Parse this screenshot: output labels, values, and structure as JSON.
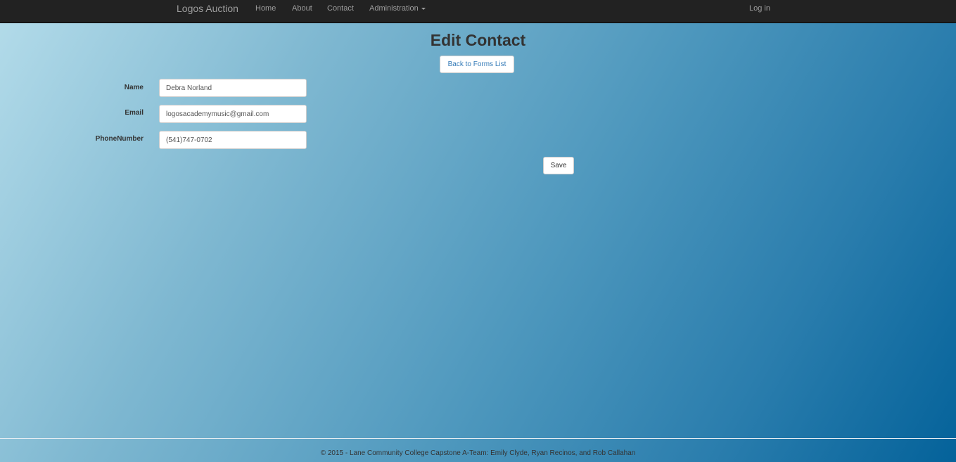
{
  "navbar": {
    "brand": "Logos Auction",
    "items": [
      {
        "label": "Home"
      },
      {
        "label": "About"
      },
      {
        "label": "Contact"
      },
      {
        "label": "Administration"
      }
    ],
    "login": "Log in"
  },
  "main": {
    "title": "Edit Contact",
    "back_button": "Back to Forms List",
    "fields": {
      "name": {
        "label": "Name",
        "value": "Debra Norland"
      },
      "email": {
        "label": "Email",
        "value": "logosacademymusic@gmail.com"
      },
      "phone": {
        "label": "PhoneNumber",
        "value": "(541)747-0702"
      }
    },
    "save_button": "Save"
  },
  "footer": {
    "text": "© 2015 - Lane Community College Capstone A-Team: Emily Clyde, Ryan Recinos, and Rob Callahan"
  },
  "icons": {
    "dropdown": "caret-down-icon"
  },
  "colors": {
    "navbar": "#222222",
    "nav_text": "#9d9d9d",
    "link": "#337ab7",
    "gradient_start": "#b4dcea",
    "gradient_end": "#04629a"
  }
}
